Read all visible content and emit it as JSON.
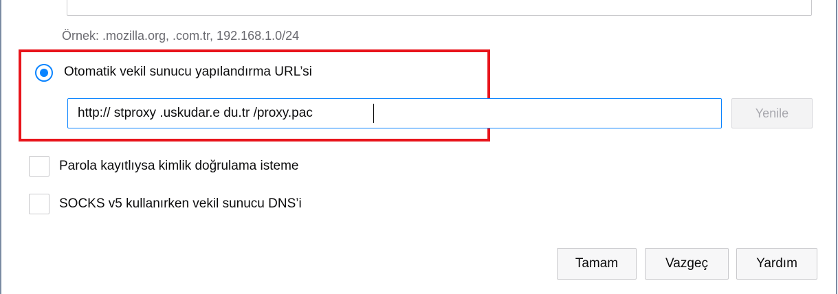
{
  "dialog": {
    "example_text": "Örnek: .mozilla.org, .com.tr, 192.168.1.0/24",
    "auto_proxy": {
      "label": "Otomatik vekil sunucu yapılandırma URL’si",
      "selected": true,
      "url_value": "http:// stproxy .uskudar.e du.tr /proxy.pac",
      "reload_label": "Yenile"
    },
    "options": [
      {
        "label": "Parola kayıtlıysa kimlik doğrulama isteme",
        "checked": false
      },
      {
        "label": "SOCKS v5 kullanırken vekil sunucu DNS’i",
        "checked": false
      }
    ],
    "buttons": {
      "ok": "Tamam",
      "cancel": "Vazgeç",
      "help": "Yardım"
    },
    "colors": {
      "accent": "#0a84ff",
      "highlight": "#e8141b"
    }
  }
}
